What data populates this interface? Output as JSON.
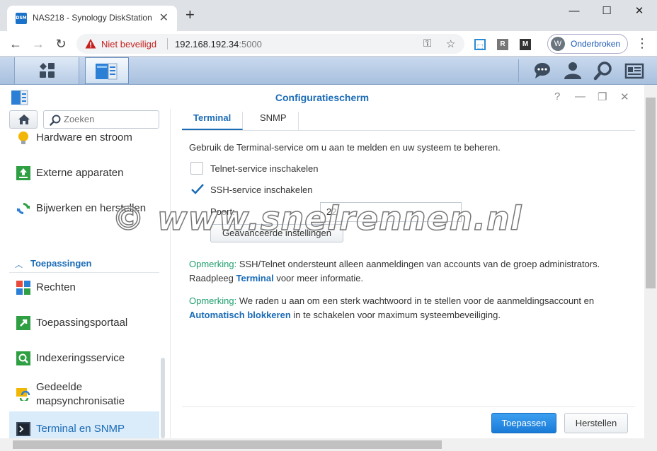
{
  "browser": {
    "tab_title": "NAS218 - Synology DiskStation",
    "favicon_text": "DSM",
    "security_label": "Niet beveiligd",
    "url_host": "192.168.192.34",
    "url_port": ":5000",
    "profile_initial": "W",
    "profile_label": "Onderbroken",
    "ext_r_label": "R"
  },
  "window": {
    "title": "Configuratiescherm",
    "help": "?"
  },
  "sidebar": {
    "search_placeholder": "Zoeken",
    "items_top": [
      {
        "label": "Hardware en stroom"
      },
      {
        "label": "Externe apparaten"
      },
      {
        "label": "Bijwerken en herstellen"
      }
    ],
    "group_label": "Toepassingen",
    "items_apps": [
      {
        "label": "Rechten"
      },
      {
        "label": "Toepassingsportaal"
      },
      {
        "label": "Indexeringsservice"
      },
      {
        "label_line1": "Gedeelde",
        "label_line2": "mapsynchronisatie"
      },
      {
        "label": "Terminal en SNMP"
      }
    ]
  },
  "content": {
    "tabs": [
      {
        "label": "Terminal"
      },
      {
        "label": "SNMP"
      }
    ],
    "intro": "Gebruik de Terminal-service om u aan te melden en uw systeem te beheren.",
    "telnet_label": "Telnet-service inschakelen",
    "telnet_checked": false,
    "ssh_label": "SSH-service inschakelen",
    "ssh_checked": true,
    "port_label": "Poort:",
    "port_value": "22",
    "advanced_button": "Geavanceerde instellingen",
    "note1_label": "Opmerking:",
    "note1_text": " SSH/Telnet ondersteunt alleen aanmeldingen van accounts van de groep administrators.",
    "note1_line2_pre": "Raadpleeg ",
    "note1_link": "Terminal",
    "note1_line2_post": " voor meer informatie.",
    "note2_label": "Opmerking:",
    "note2_text": " We raden u aan om een sterk wachtwoord in te stellen voor de aanmeldingsaccount en",
    "note2_link": "Automatisch blokkeren",
    "note2_line2_post": " in te schakelen voor maximum systeembeveiliging.",
    "apply_button": "Toepassen",
    "reset_button": "Herstellen"
  },
  "watermark": "© www.snelrennen.nl",
  "colors": {
    "accent": "#1b6cb7",
    "note_green": "#1f9e6e",
    "active_item_bg": "#daebf9",
    "warning_red": "#c5221f"
  }
}
